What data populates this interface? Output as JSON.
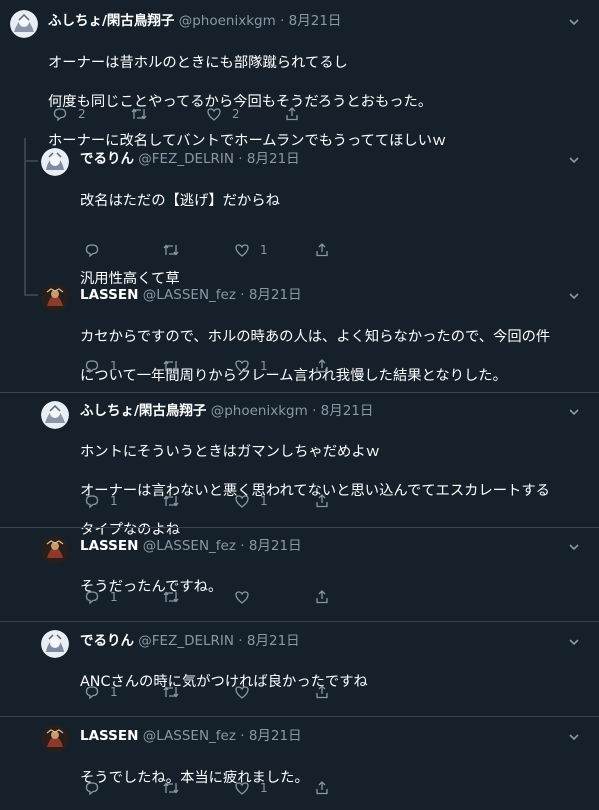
{
  "colors": {
    "background": "#15202b",
    "text": "#ffffff",
    "secondary": "#8899a6",
    "divider": "#38444d"
  },
  "tweets": [
    {
      "name": "ふしちょ/閑古鳥翔子",
      "handle": "@phoenixkgm",
      "date": "8月21日",
      "lines": [
        "オーナーは昔ホルのときにも部隊蹴られてるし",
        "何度も同じことやってるから今回もそうだろうとおもった。",
        "ホーナーに改名してバントでホームランでもうっててほしいｗ"
      ],
      "reply_count": "2",
      "retweet_count": "",
      "like_count": "2",
      "icons": [
        "reply-icon",
        "retweet-icon",
        "like-icon",
        "share-icon"
      ]
    },
    {
      "name": "でるりん",
      "handle": "@FEZ_DELRIN",
      "date": "8月21日",
      "lines": [
        "改名はただの【逃げ】だからね",
        "",
        "汎用性高くて草"
      ],
      "reply_count": "",
      "retweet_count": "",
      "like_count": "1"
    },
    {
      "name": "LASSEN",
      "handle": "@LASSEN_fez",
      "date": "8月21日",
      "lines": [
        "カセからですので、ホルの時あの人は、よく知らなかったので、今回の件",
        "について一年間周りからクレーム言われ我慢した結果となりした。"
      ],
      "reply_count": "1",
      "retweet_count": "",
      "like_count": "1"
    },
    {
      "name": "ふしちょ/閑古鳥翔子",
      "handle": "@phoenixkgm",
      "date": "8月21日",
      "lines": [
        "ホントにそういうときはガマンしちゃだめよｗ",
        "オーナーは言わないと悪く思われてないと思い込んでてエスカレートする",
        "タイプなのよね"
      ],
      "reply_count": "1",
      "retweet_count": "",
      "like_count": "1"
    },
    {
      "name": "LASSEN",
      "handle": "@LASSEN_fez",
      "date": "8月21日",
      "lines": [
        "そうだったんですね。"
      ],
      "reply_count": "1",
      "retweet_count": "",
      "like_count": ""
    },
    {
      "name": "でるりん",
      "handle": "@FEZ_DELRIN",
      "date": "8月21日",
      "lines": [
        "ANCさんの時に気がつければ良かったですね"
      ],
      "reply_count": "1",
      "retweet_count": "",
      "like_count": ""
    },
    {
      "name": "LASSEN",
      "handle": "@LASSEN_fez",
      "date": "8月21日",
      "lines": [
        "そうでしたね。本当に疲れました。"
      ],
      "reply_count": "",
      "retweet_count": "",
      "like_count": "1"
    }
  ]
}
